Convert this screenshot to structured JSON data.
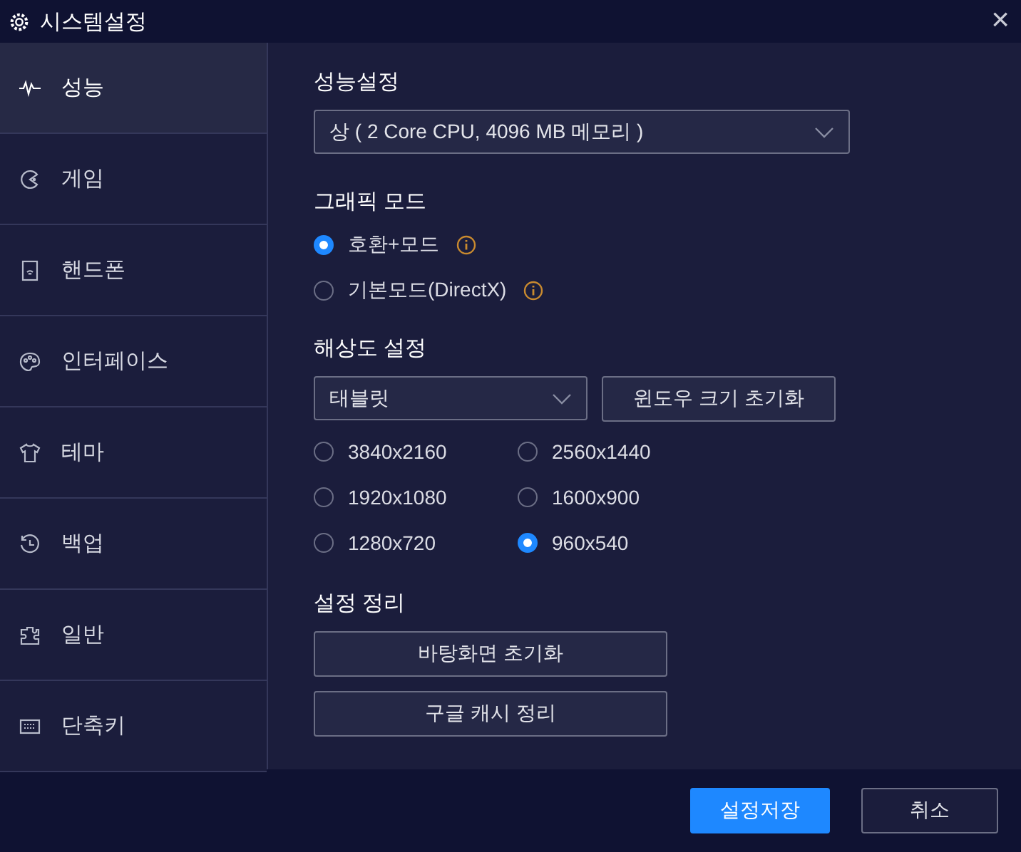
{
  "window": {
    "title": "시스템설정",
    "close": "×"
  },
  "sidebar": {
    "items": [
      {
        "label": "성능",
        "selected": true
      },
      {
        "label": "게임",
        "selected": false
      },
      {
        "label": "핸드폰",
        "selected": false
      },
      {
        "label": "인터페이스",
        "selected": false
      },
      {
        "label": "테마",
        "selected": false
      },
      {
        "label": "백업",
        "selected": false
      },
      {
        "label": "일반",
        "selected": false
      },
      {
        "label": "단축키",
        "selected": false
      }
    ]
  },
  "performance": {
    "title": "성능설정",
    "dropdown": {
      "value": "상 ( 2 Core CPU, 4096 MB 메모리 )"
    }
  },
  "graphics": {
    "title": "그래픽 모드",
    "options": [
      {
        "label": "호환+모드",
        "selected": true
      },
      {
        "label": "기본모드(DirectX)",
        "selected": false
      }
    ]
  },
  "resolution": {
    "title": "해상도 설정",
    "dropdown": {
      "value": "태블릿"
    },
    "reset_button": "윈도우 크기 초기화",
    "options": [
      {
        "label": "3840x2160",
        "selected": false
      },
      {
        "label": "2560x1440",
        "selected": false
      },
      {
        "label": "1920x1080",
        "selected": false
      },
      {
        "label": "1600x900",
        "selected": false
      },
      {
        "label": "1280x720",
        "selected": false
      },
      {
        "label": "960x540",
        "selected": true
      }
    ]
  },
  "cleanup": {
    "title": "설정 정리",
    "buttons": [
      "바탕화면 초기화",
      "구글 캐시 정리"
    ]
  },
  "footer": {
    "save": "설정저장",
    "cancel": "취소"
  }
}
